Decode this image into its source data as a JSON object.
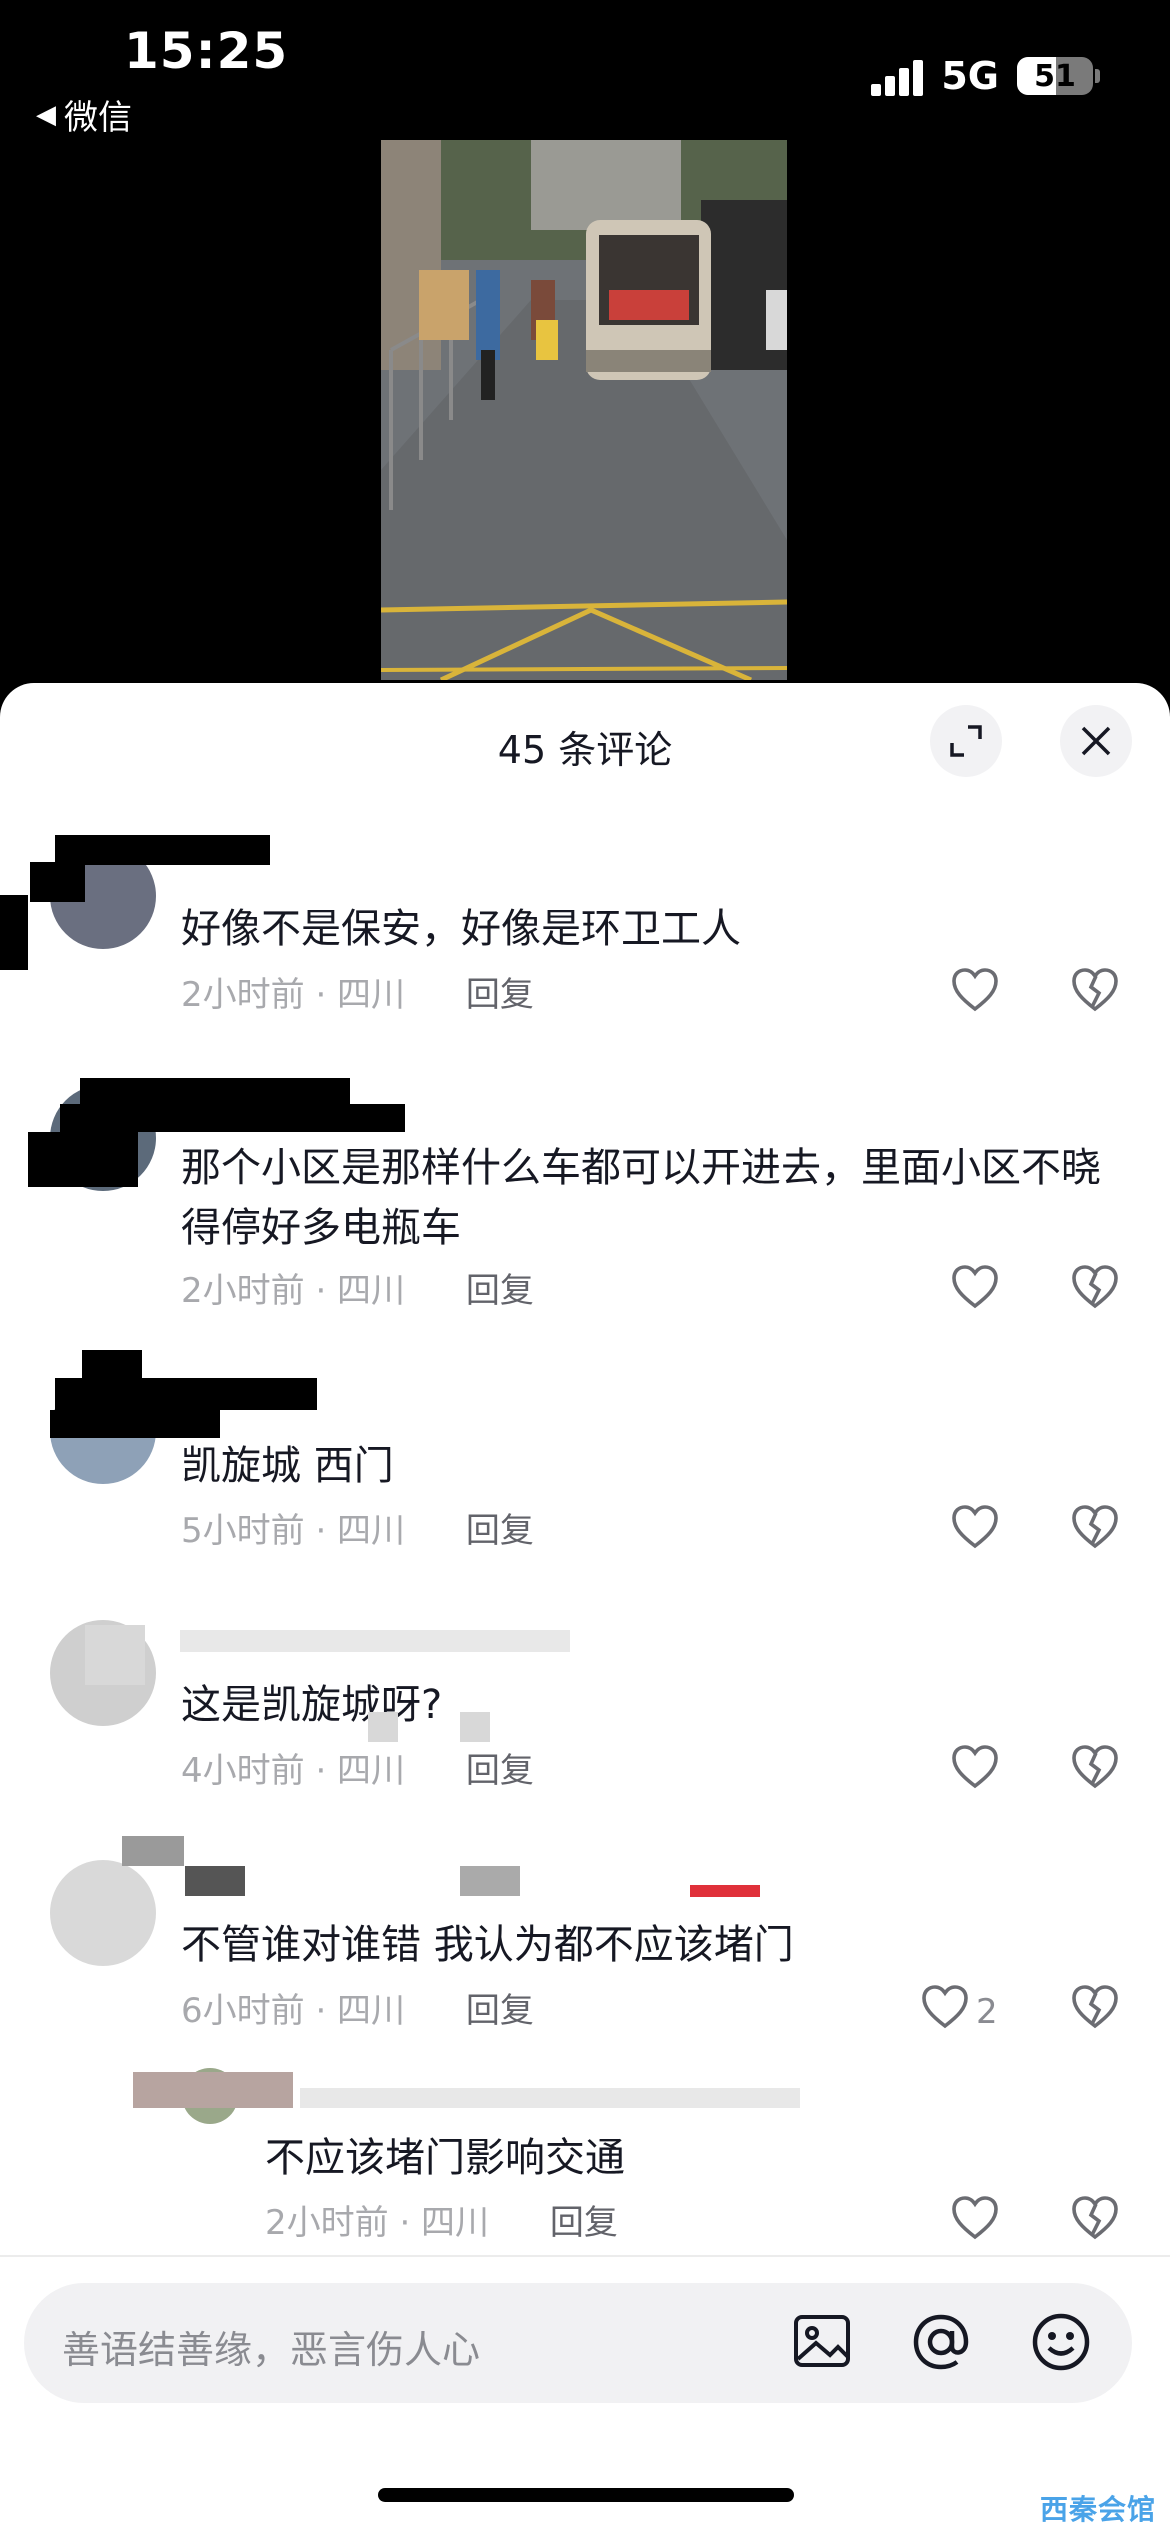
{
  "status_bar": {
    "time": "15:25",
    "back_label": "微信",
    "network": "5G",
    "battery": "51",
    "battery_level": 0.51
  },
  "sheet": {
    "title": "45 条评论"
  },
  "comments": [
    {
      "text": "好像不是保安，好像是环卫工人",
      "time": "2小时前 · 四川",
      "reply": "回复",
      "likes": ""
    },
    {
      "text": "那个小区是那样什么车都可以开进去，里面小区不晓得停好多电瓶车",
      "time": "2小时前 · 四川",
      "reply": "回复",
      "likes": ""
    },
    {
      "text": "凯旋城 西门",
      "time": "5小时前 · 四川",
      "reply": "回复",
      "likes": ""
    },
    {
      "text": "这是凯旋城呀?",
      "time": "4小时前 · 四川",
      "reply": "回复",
      "likes": ""
    },
    {
      "text": "不管谁对谁错  我认为都不应该堵门",
      "time": "6小时前 · 四川",
      "reply": "回复",
      "likes": "2"
    },
    {
      "text": "不应该堵门影响交通",
      "time": "2小时前 · 四川",
      "reply": "回复",
      "likes": ""
    }
  ],
  "input": {
    "placeholder": "善语结善缘，恶言伤人心"
  },
  "icons": {
    "expand": "expand-icon",
    "close": "close-icon",
    "like": "heart-icon",
    "dislike": "broken-heart-icon",
    "image": "image-icon",
    "mention": "at-icon",
    "emoji": "emoji-icon"
  },
  "watermark": "西秦会馆"
}
